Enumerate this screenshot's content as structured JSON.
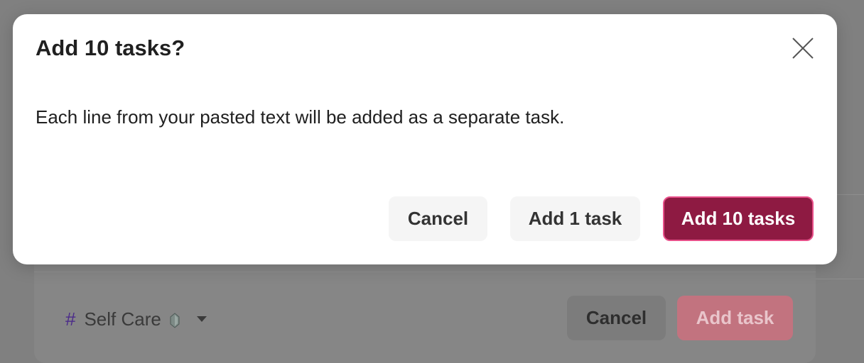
{
  "dialog": {
    "title": "Add 10 tasks?",
    "message": "Each line from your pasted text will be added as a separate task.",
    "cancel_label": "Cancel",
    "add_one_label": "Add 1 task",
    "add_all_label": "Add 10 tasks",
    "close_icon": "close-icon",
    "accent_color": "#8e1a42"
  },
  "task_editor": {
    "project_prefix": "#",
    "project_name": "Self Care",
    "project_icon": "gem-icon",
    "cancel_label": "Cancel",
    "add_label": "Add task"
  }
}
